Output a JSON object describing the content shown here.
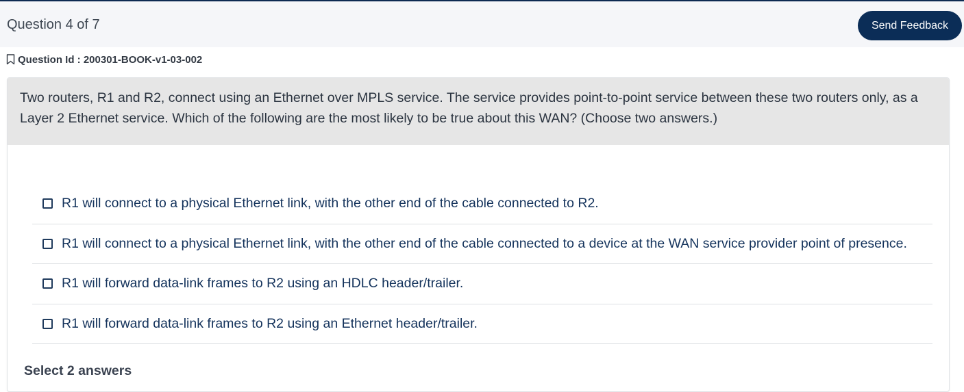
{
  "header": {
    "progress": "Question 4 of 7",
    "feedback_label": "Send Feedback"
  },
  "question_id": {
    "label": "Question Id : 200301-BOOK-v1-03-002",
    "icon": "bookmark-icon"
  },
  "question": {
    "text": "Two routers, R1 and R2, connect using an Ethernet over MPLS service. The service provides point-to-point service between these two routers only, as a Layer 2 Ethernet service. Which of the following are the most likely to be true about this WAN? (Choose two answers.)"
  },
  "options": [
    {
      "text": "R1 will connect to a physical Ethernet link, with the other end of the cable connected to R2.",
      "checked": false
    },
    {
      "text": "R1 will connect to a physical Ethernet link, with the other end of the cable connected to a device at the WAN service provider point of presence.",
      "checked": false
    },
    {
      "text": "R1 will forward data-link frames to R2 using an HDLC header/trailer.",
      "checked": false
    },
    {
      "text": "R1 will forward data-link frames to R2 using an Ethernet header/trailer.",
      "checked": false
    }
  ],
  "footer": {
    "hint": "Select 2 answers"
  },
  "colors": {
    "accent": "#0b2d57",
    "question_bg": "#e6e6e6",
    "header_bg": "#f5f6f9"
  }
}
